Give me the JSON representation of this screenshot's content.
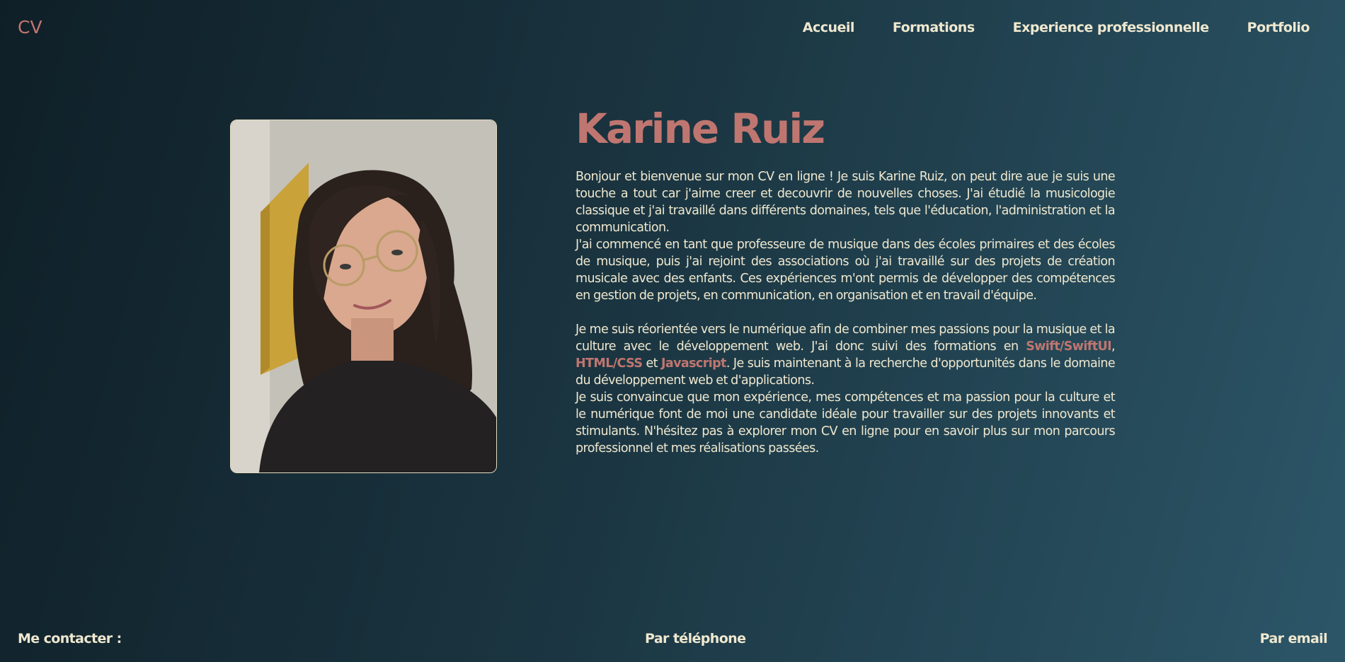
{
  "header": {
    "logo": "CV",
    "nav": [
      {
        "label": "Accueil"
      },
      {
        "label": "Formations"
      },
      {
        "label": "Experience professionnelle"
      },
      {
        "label": "Portfolio"
      }
    ]
  },
  "profile": {
    "photo_alt": "portrait-photo",
    "name": "Karine Ruiz",
    "bio": {
      "p1": "Bonjour et bienvenue sur mon CV en ligne ! Je suis Karine Ruiz, on peut dire aue je suis une touche a tout car j'aime creer et decouvrir de nouvelles choses. J'ai étudié la musicologie classique et j'ai travaillé dans différents domaines, tels que l'éducation, l'administration et la communication.",
      "p2": "J'ai commencé en tant que professeure de musique dans des écoles primaires et des écoles de musique, puis j'ai rejoint des associations où j'ai travaillé sur des projets de création musicale avec des enfants. Ces expériences m'ont permis de développer des compétences en gestion de projets, en communication, en organisation et en travail d'équipe.",
      "p3_start": "Je me suis réorientée vers le numérique afin de combiner mes passions pour la musique et la culture avec le développement web. J'ai donc suivi des formations en ",
      "skill1": "Swift/SwiftUI",
      "sep1": ", ",
      "skill2": "HTML/CSS",
      "sep2": " et ",
      "skill3": "Javascript",
      "p3_end": ". Je suis maintenant à la recherche d'opportunités dans le domaine du développement web et d'applications.",
      "p4": "Je suis convaincue que mon expérience, mes compétences et ma passion pour la culture et le numérique font de moi une candidate idéale pour travailler sur des projets innovants et stimulants. N'hésitez pas à explorer mon CV en ligne pour en savoir plus sur mon parcours professionnel et mes réalisations passées."
    }
  },
  "footer": {
    "contact_label": "Me contacter :",
    "phone_label": "Par téléphone",
    "email_label": "Par email"
  },
  "colors": {
    "accent": "#c07670",
    "text": "#efe8cf",
    "bg_dark": "#0f1f27",
    "bg_light": "#2c5668"
  }
}
